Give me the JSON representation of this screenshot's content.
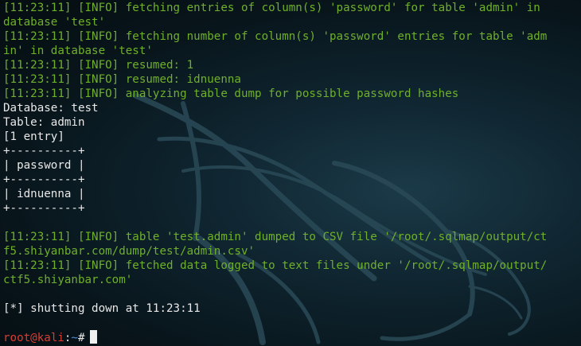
{
  "terminal": {
    "lines": [
      {
        "kind": "log",
        "text": "[11:23:11] [INFO] fetching entries of column(s) 'password' for table 'admin' in"
      },
      {
        "kind": "log",
        "text": "database 'test'"
      },
      {
        "kind": "log",
        "text": "[11:23:11] [INFO] fetching number of column(s) 'password' entries for table 'adm"
      },
      {
        "kind": "log",
        "text": "in' in database 'test'"
      },
      {
        "kind": "log",
        "text": "[11:23:11] [INFO] resumed: 1"
      },
      {
        "kind": "log",
        "text": "[11:23:11] [INFO] resumed: idnuenna"
      },
      {
        "kind": "log",
        "text": "[11:23:11] [INFO] analyzing table dump for possible password hashes"
      },
      {
        "kind": "out",
        "text": "Database: test"
      },
      {
        "kind": "out",
        "text": "Table: admin"
      },
      {
        "kind": "out",
        "text": "[1 entry]"
      },
      {
        "kind": "out",
        "text": "+----------+"
      },
      {
        "kind": "out",
        "text": "| password |"
      },
      {
        "kind": "out",
        "text": "+----------+"
      },
      {
        "kind": "out",
        "text": "| idnuenna |"
      },
      {
        "kind": "out",
        "text": "+----------+"
      },
      {
        "kind": "blank",
        "text": ""
      },
      {
        "kind": "log",
        "text": "[11:23:11] [INFO] table 'test.admin' dumped to CSV file '/root/.sqlmap/output/ct"
      },
      {
        "kind": "log",
        "text": "f5.shiyanbar.com/dump/test/admin.csv'"
      },
      {
        "kind": "log",
        "text": "[11:23:11] [INFO] fetched data logged to text files under '/root/.sqlmap/output/"
      },
      {
        "kind": "log",
        "text": "ctf5.shiyanbar.com'"
      },
      {
        "kind": "blank",
        "text": ""
      },
      {
        "kind": "out",
        "text": "[*] shutting down at 11:23:11"
      },
      {
        "kind": "blank",
        "text": ""
      }
    ],
    "prompt": {
      "user_host": "root@kali",
      "separator": ":",
      "path": "~",
      "symbol": "#"
    }
  }
}
